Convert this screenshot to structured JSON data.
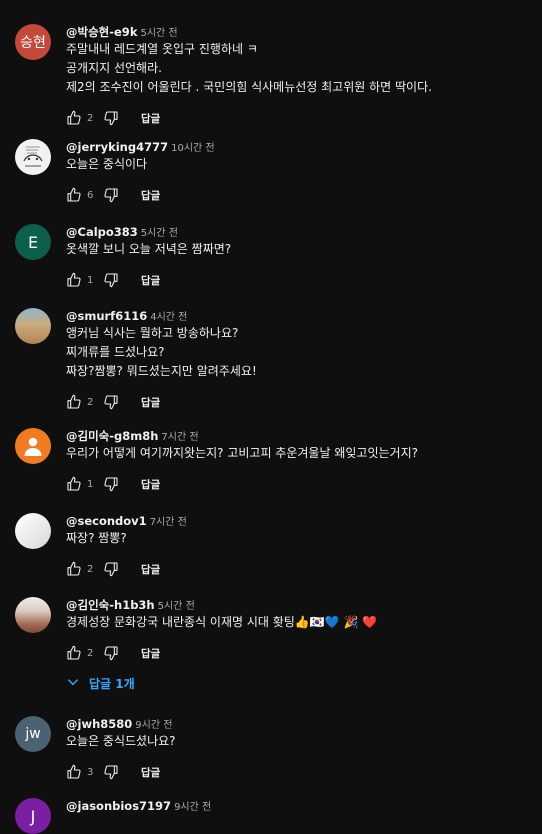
{
  "comments": [
    {
      "author": "@박승현-e9k",
      "time": "5시간 전",
      "avatar": {
        "type": "letter",
        "text": "승현",
        "color": "#c5493a"
      },
      "lines": [
        "주말내내 레드계열 옷입구 진행하네 ㅋ",
        "공개지지 선언해라.",
        "제2의 조수진이 어울린다 .  국민의힘 식사메뉴선정 최고위원 하면 딱이다."
      ],
      "likes": "2",
      "reply_label": "답글"
    },
    {
      "author": "@jerryking4777",
      "time": "10시간 전",
      "avatar": {
        "type": "sketch"
      },
      "lines": [
        "오늘은 중식이다"
      ],
      "likes": "6",
      "reply_label": "답글"
    },
    {
      "author": "@Calpo383",
      "time": "5시간 전",
      "avatar": {
        "type": "letter",
        "text": "E",
        "color": "#0b5f4c"
      },
      "lines": [
        "옷색깔 보니 오늘 저녁은 짬짜면?"
      ],
      "likes": "1",
      "reply_label": "답글"
    },
    {
      "author": "@smurf6116",
      "time": "4시간 전",
      "avatar": {
        "type": "photo-desert"
      },
      "lines": [
        "앵커님 식사는 뭘하고 방송하나요?",
        "찌개류를 드셨나요?",
        "짜장?짬뽕? 뭐드셨는지만 알려주세요!"
      ],
      "likes": "2",
      "reply_label": "답글"
    },
    {
      "author": "@김미숙-g8m8h",
      "time": "7시간 전",
      "avatar": {
        "type": "default-person",
        "color": "#ef7b22"
      },
      "lines": [
        "우리가 어떻게 여기까지왓는지?  고비고피 추운겨울날 왜잊고잇는거지?"
      ],
      "likes": "1",
      "reply_label": "답글"
    },
    {
      "author": "@secondov1",
      "time": "7시간 전",
      "avatar": {
        "type": "photo-white"
      },
      "lines": [
        "짜장? 짬뽕?"
      ],
      "likes": "2",
      "reply_label": "답글"
    },
    {
      "author": "@김인숙-h1b3h",
      "time": "5시간 전",
      "avatar": {
        "type": "photo-table"
      },
      "lines": [
        "경제성장  문화강국  내란종식  이재명  시대  홧팅👍🇰🇷💙  🎉 ❤️"
      ],
      "likes": "2",
      "reply_label": "답글",
      "replies_toggle": "답글 1개"
    },
    {
      "author": "@jwh8580",
      "time": "9시간 전",
      "avatar": {
        "type": "letter",
        "text": "jw",
        "color": "#4b6272"
      },
      "lines": [
        "오늘은 중식드셨나요?"
      ],
      "likes": "3",
      "reply_label": "답글"
    },
    {
      "author": "@jasonbios7197",
      "time": "9시간 전",
      "avatar": {
        "type": "letter",
        "text": "J",
        "color": "#7a1fa2"
      },
      "lines": [],
      "likes": "",
      "reply_label": ""
    }
  ]
}
